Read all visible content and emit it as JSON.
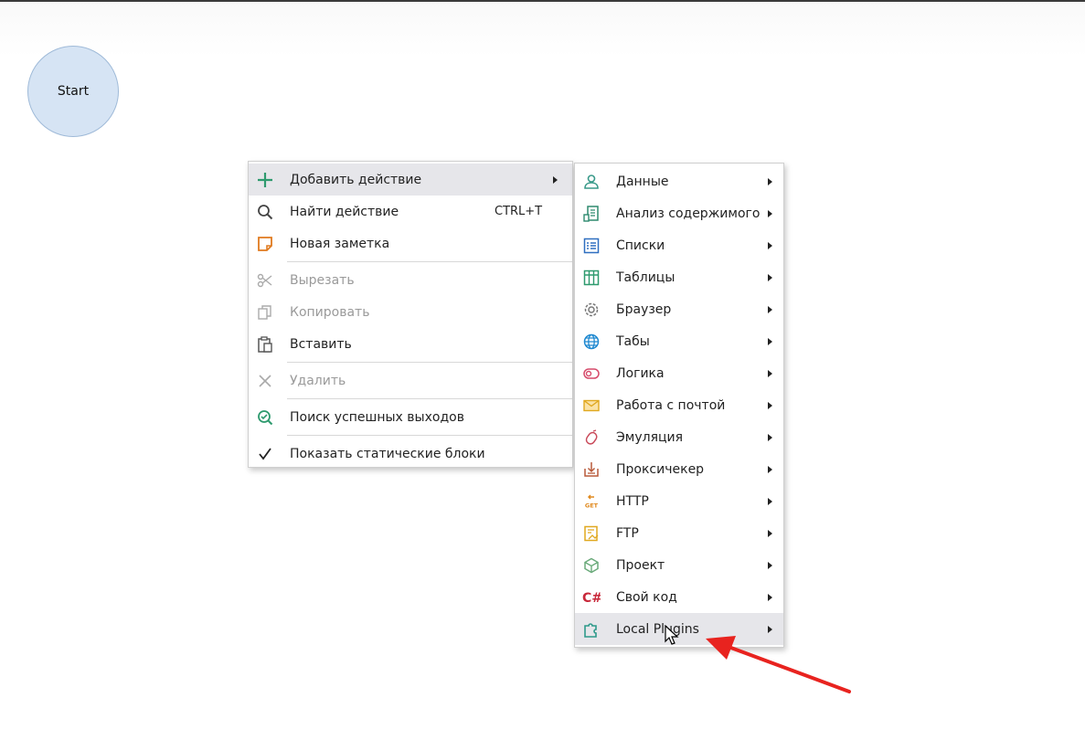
{
  "canvas": {
    "start_node_label": "Start"
  },
  "context_menu": {
    "items": [
      {
        "label": "Добавить действие",
        "icon": "plus-icon",
        "has_submenu": true,
        "highlighted": true
      },
      {
        "label": "Найти действие",
        "icon": "search-icon",
        "shortcut": "CTRL+T"
      },
      {
        "label": "Новая заметка",
        "icon": "note-icon"
      },
      {
        "label": "Вырезать",
        "icon": "scissors-icon",
        "disabled": true
      },
      {
        "label": "Копировать",
        "icon": "copy-icon",
        "disabled": true
      },
      {
        "label": "Вставить",
        "icon": "paste-icon"
      },
      {
        "label": "Удалить",
        "icon": "delete-icon",
        "disabled": true
      },
      {
        "label": "Поиск успешных выходов",
        "icon": "search-success-icon"
      },
      {
        "label": "Показать статические блоки",
        "icon": "checkmark-icon",
        "checked": true
      }
    ]
  },
  "submenu": {
    "items": [
      {
        "label": "Данные",
        "icon": "person-icon"
      },
      {
        "label": "Анализ содержимого",
        "icon": "document-analysis-icon"
      },
      {
        "label": "Списки",
        "icon": "list-icon"
      },
      {
        "label": "Таблицы",
        "icon": "table-icon"
      },
      {
        "label": "Браузер",
        "icon": "gear-icon"
      },
      {
        "label": "Табы",
        "icon": "globe-icon"
      },
      {
        "label": "Логика",
        "icon": "toggle-icon"
      },
      {
        "label": "Работа с почтой",
        "icon": "mail-icon"
      },
      {
        "label": "Эмуляция",
        "icon": "mouse-icon"
      },
      {
        "label": "Проксичекер",
        "icon": "proxy-download-icon"
      },
      {
        "label": "HTTP",
        "icon": "http-get-icon",
        "icon_text": "GET"
      },
      {
        "label": "FTP",
        "icon": "ftp-icon"
      },
      {
        "label": "Проект",
        "icon": "cube-icon"
      },
      {
        "label": "Свой код",
        "icon": "csharp-icon",
        "icon_text": "C#"
      },
      {
        "label": "Local Plugins",
        "icon": "puzzle-icon",
        "highlighted": true
      }
    ]
  },
  "colors": {
    "accent_green": "#2e9a6e",
    "highlight": "#e6e6ea",
    "disabled_text": "#9a9a9a",
    "annotation_arrow": "#e8231f",
    "start_node_fill": "#d6e4f4"
  }
}
